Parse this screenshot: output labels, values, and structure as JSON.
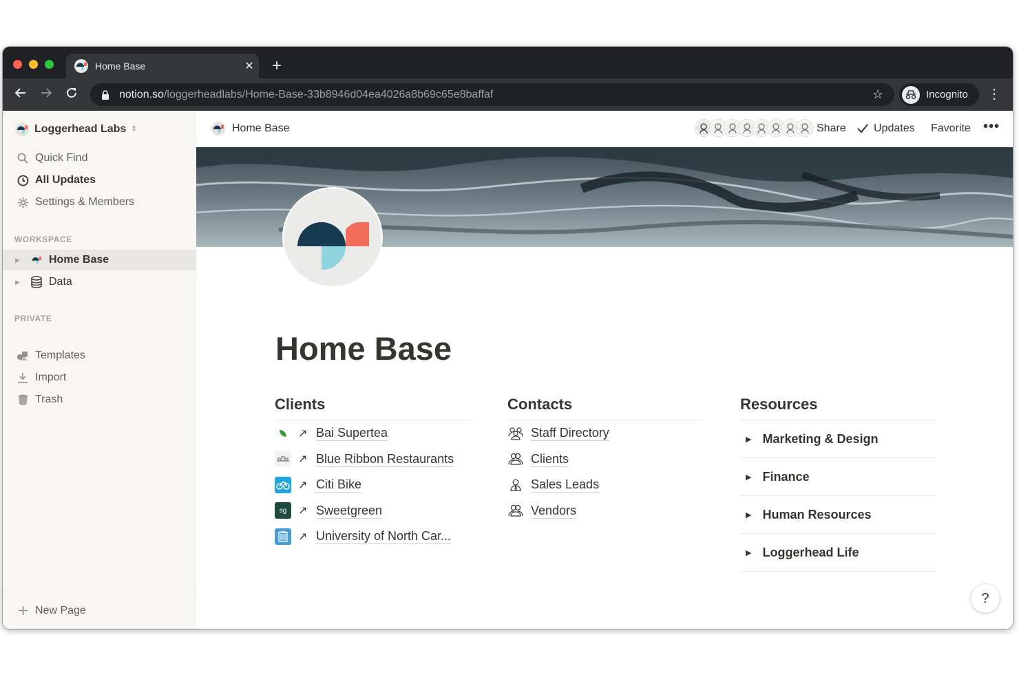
{
  "browser": {
    "tab_title": "Home Base",
    "tab_close": "✕",
    "new_tab": "+",
    "url_host": "notion.so",
    "url_path": "/loggerheadlabs/Home-Base-33b8946d04ea4026a8b69c65e8baffaf",
    "profile_label": "Incognito"
  },
  "sidebar": {
    "workspace_name": "Loggerhead Labs",
    "nav": [
      {
        "label": "Quick Find",
        "icon": "search-icon"
      },
      {
        "label": "All Updates",
        "icon": "clock-icon"
      },
      {
        "label": "Settings & Members",
        "icon": "gear-icon"
      }
    ],
    "workspace_section": "WORKSPACE",
    "workspace_pages": [
      {
        "label": "Home Base",
        "icon": "loggerhead-logo-icon"
      },
      {
        "label": "Data",
        "icon": "database-icon"
      }
    ],
    "private_section": "PRIVATE",
    "tools": [
      {
        "label": "Templates",
        "icon": "templates-icon"
      },
      {
        "label": "Import",
        "icon": "import-icon"
      },
      {
        "label": "Trash",
        "icon": "trash-icon"
      }
    ],
    "new_page": "New Page"
  },
  "topbar": {
    "breadcrumb": "Home Base",
    "share": "Share",
    "updates": "Updates",
    "favorite": "Favorite",
    "more": "•••"
  },
  "page": {
    "title": "Home Base",
    "clients": {
      "heading": "Clients",
      "items": [
        {
          "label": "Bai Supertea",
          "icon": "bai-leaf-icon"
        },
        {
          "label": "Blue Ribbon Restaurants",
          "icon": "blue-ribbon-icon"
        },
        {
          "label": "Citi Bike",
          "icon": "bike-icon"
        },
        {
          "label": "Sweetgreen",
          "icon": "sweetgreen-icon",
          "icon_text": "sg"
        },
        {
          "label": "University of North Car...",
          "icon": "unc-icon"
        }
      ]
    },
    "contacts": {
      "heading": "Contacts",
      "items": [
        {
          "label": "Staff Directory",
          "icon": "group-icon"
        },
        {
          "label": "Clients",
          "icon": "people-icon"
        },
        {
          "label": "Sales Leads",
          "icon": "person-icon"
        },
        {
          "label": "Vendors",
          "icon": "people-icon"
        }
      ]
    },
    "resources": {
      "heading": "Resources",
      "items": [
        {
          "label": "Marketing & Design"
        },
        {
          "label": "Finance"
        },
        {
          "label": "Human Resources"
        },
        {
          "label": "Loggerhead Life"
        }
      ]
    }
  },
  "help": "?",
  "colors": {
    "logo_navy": "#163a4f",
    "logo_coral": "#f26d5b",
    "logo_aqua": "#8fd3dc",
    "sidebar_bg": "#f7f6f3",
    "text": "#37352f",
    "citibike_blue": "#1ea5e0",
    "sweetgreen_green": "#1f4b3f",
    "unc_blue": "#4b9cd3"
  }
}
